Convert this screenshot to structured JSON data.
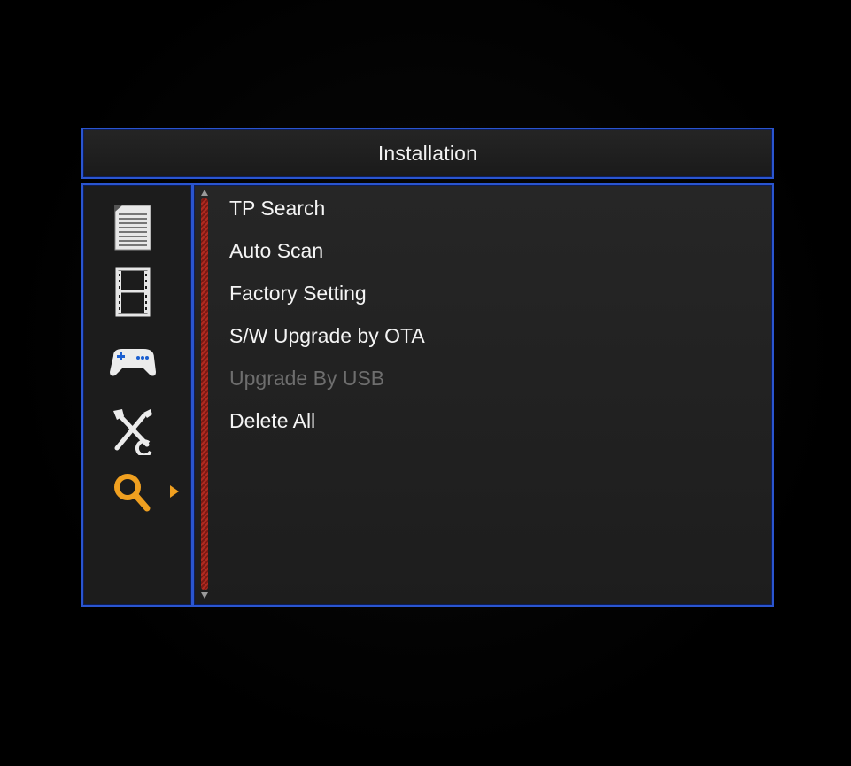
{
  "header": {
    "title": "Installation"
  },
  "sidebar": {
    "icons": [
      {
        "name": "document-list-icon",
        "selected": false
      },
      {
        "name": "film-strip-icon",
        "selected": false
      },
      {
        "name": "gamepad-icon",
        "selected": false
      },
      {
        "name": "tools-icon",
        "selected": false
      },
      {
        "name": "search-magnifier-icon",
        "selected": true
      }
    ],
    "highlight_color": "#f0a020"
  },
  "menu": {
    "items": [
      {
        "label": "TP Search",
        "enabled": true
      },
      {
        "label": "Auto Scan",
        "enabled": true
      },
      {
        "label": "Factory Setting",
        "enabled": true
      },
      {
        "label": "S/W Upgrade by OTA",
        "enabled": true
      },
      {
        "label": "Upgrade By USB",
        "enabled": false
      },
      {
        "label": "Delete All",
        "enabled": true
      }
    ]
  },
  "colors": {
    "border": "#2a55d0",
    "background": "#000000",
    "scrollbar": "#b02a20",
    "text": "#f4f4f4",
    "disabled_text": "#6e6e6e"
  }
}
